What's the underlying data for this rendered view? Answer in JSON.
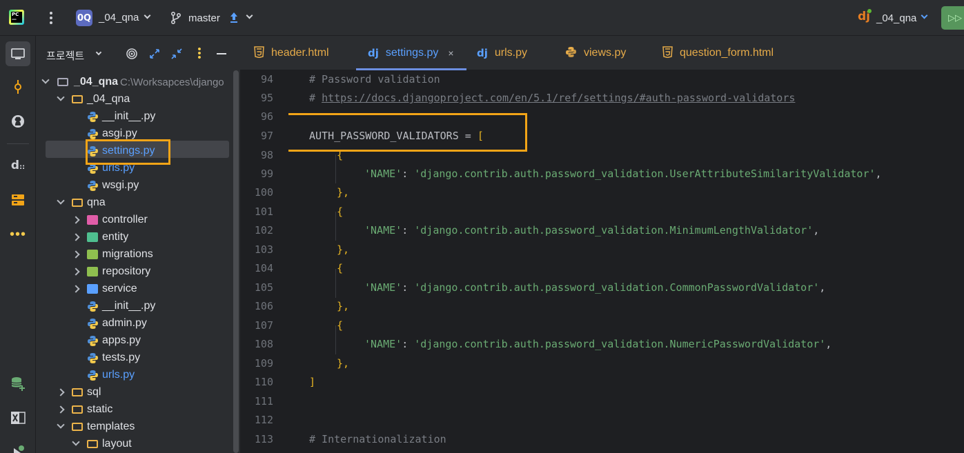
{
  "titlebar": {
    "project_badge": "0Q",
    "project_name": "_04_qna",
    "branch_name": "master",
    "run_config_icon": "dj",
    "run_config_name": "_04_qna"
  },
  "toolstrip": {
    "icons": [
      "project-icon",
      "commit-icon",
      "github-icon",
      "django-icon",
      "structure-icon",
      "more-icon",
      "database-icon",
      "excel-icon",
      "run-icon"
    ]
  },
  "project_panel": {
    "title": "프로젝트",
    "root_label": "_04_qna",
    "root_path": "C:\\Worksapces\\django",
    "tree": [
      {
        "label": "_04_qna",
        "type": "folder",
        "level": 1,
        "expanded": true
      },
      {
        "label": "__init__.py",
        "type": "python",
        "level": 2
      },
      {
        "label": "asgi.py",
        "type": "python",
        "level": 2
      },
      {
        "label": "settings.py",
        "type": "python",
        "level": 2,
        "selected": true
      },
      {
        "label": "urls.py",
        "type": "python",
        "level": 2
      },
      {
        "label": "wsgi.py",
        "type": "python",
        "level": 2
      },
      {
        "label": "qna",
        "type": "folder",
        "level": 1,
        "expanded": true
      },
      {
        "label": "controller",
        "type": "package",
        "level": 2
      },
      {
        "label": "entity",
        "type": "package",
        "level": 2
      },
      {
        "label": "migrations",
        "type": "package",
        "level": 2
      },
      {
        "label": "repository",
        "type": "package",
        "level": 2
      },
      {
        "label": "service",
        "type": "package",
        "level": 2
      },
      {
        "label": "__init__.py",
        "type": "python",
        "level": 2
      },
      {
        "label": "admin.py",
        "type": "python",
        "level": 2
      },
      {
        "label": "apps.py",
        "type": "python",
        "level": 2
      },
      {
        "label": "tests.py",
        "type": "python",
        "level": 2
      },
      {
        "label": "urls.py",
        "type": "python",
        "level": 2
      },
      {
        "label": "sql",
        "type": "folder",
        "level": 1
      },
      {
        "label": "static",
        "type": "folder",
        "level": 1
      },
      {
        "label": "templates",
        "type": "folder",
        "level": 1,
        "expanded": true
      },
      {
        "label": "layout",
        "type": "folder",
        "level": 2,
        "expanded": true
      }
    ]
  },
  "tabs": [
    {
      "label": "header.html",
      "icon": "html-icon",
      "active": false
    },
    {
      "label": "settings.py",
      "icon": "django-icon",
      "active": true,
      "close": "×"
    },
    {
      "label": "urls.py",
      "icon": "django-icon",
      "active": false
    },
    {
      "label": "views.py",
      "icon": "python-icon",
      "active": false
    },
    {
      "label": "question_form.html",
      "icon": "html-icon",
      "active": false
    }
  ],
  "editor": {
    "line_numbers": [
      "94",
      "95",
      "96",
      "97",
      "98",
      "99",
      "100",
      "101",
      "102",
      "103",
      "104",
      "105",
      "106",
      "107",
      "108",
      "109",
      "110",
      "111",
      "112",
      "113"
    ],
    "lines": {
      "l94": "# Password validation",
      "l95_hash": "# ",
      "l95_link": "https://docs.djangoproject.com/en/5.1/ref/settings/#auth-password-validators",
      "l97_name": "AUTH_PASSWORD_VALIDATORS = ",
      "l97_bracket": "[",
      "open_brace": "{",
      "close_brace": "},",
      "name_key": "'NAME'",
      "colon": ": ",
      "comma": ",",
      "v99": "'django.contrib.auth.password_validation.UserAttributeSimilarityValidator'",
      "v102": "'django.contrib.auth.password_validation.MinimumLengthValidator'",
      "v105": "'django.contrib.auth.password_validation.CommonPasswordValidator'",
      "v108": "'django.contrib.auth.password_validation.NumericPasswordValidator'",
      "l110": "]",
      "l113": "# Internationalization"
    }
  },
  "colors": {
    "highlight_box": "#f2a417",
    "accent_blue": "#5aa0ff",
    "string_green": "#6aab73",
    "bracket_yellow": "#e6b422"
  }
}
